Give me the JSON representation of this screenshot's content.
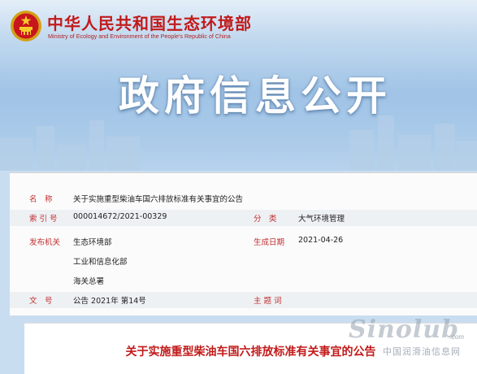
{
  "header": {
    "ministry_cn": "中华人民共和国生态环境部",
    "ministry_en": "Ministry of Ecology and Environment of the People's Republic of China",
    "banner_title": "政府信息公开",
    "emblem_icon": "national-emblem-icon"
  },
  "info": {
    "name_label": "名　称",
    "name_value": "关于实施重型柴油车国六排放标准有关事宜的公告",
    "index_label": "索 引 号",
    "index_value": "000014672/2021-00329",
    "category_label": "分　类",
    "category_value": "大气环境管理",
    "issuer_label": "发布机关",
    "issuers": [
      "生态环境部",
      "工业和信息化部",
      "海关总署"
    ],
    "date_label": "生成日期",
    "date_value": "2021-04-26",
    "docno_label": "文　号",
    "docno_value": "公告 2021年 第14号",
    "keywords_label": "主 题 词",
    "keywords_value": ""
  },
  "article": {
    "title": "关于实施重型柴油车国六排放标准有关事宜的公告"
  },
  "watermark": {
    "logo": "Sinolub",
    "url": ".com",
    "cn": "中国润滑油信息网"
  },
  "colors": {
    "brand_red": "#c21a1a",
    "label_red": "#c23030",
    "sky_blue": "#9fc3e6"
  }
}
